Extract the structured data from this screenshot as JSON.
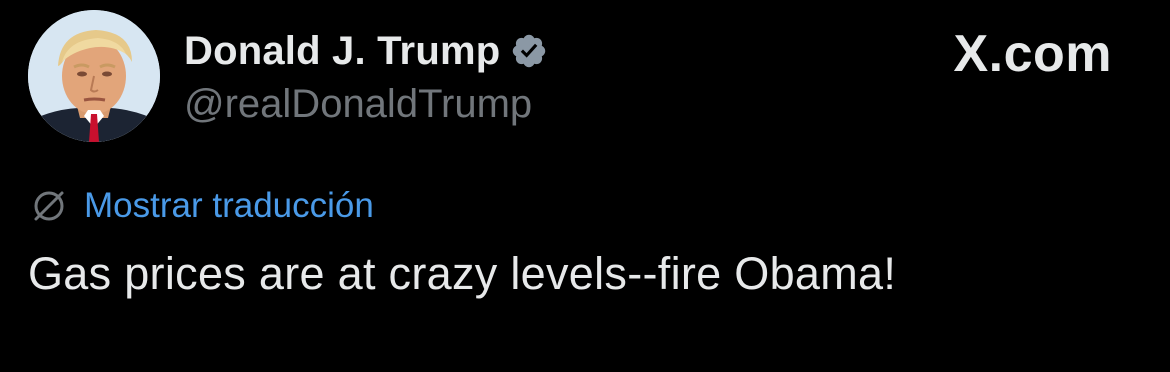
{
  "author": {
    "display_name": "Donald J. Trump",
    "handle": "@realDonaldTrump",
    "verified": true,
    "avatar_icon": "profile-photo-icon",
    "verified_icon": "verified-badge-icon"
  },
  "brand": {
    "label": "X.com"
  },
  "translation": {
    "icon": "translate-globe-icon",
    "label": "Mostrar traducción"
  },
  "tweet": {
    "text": "Gas prices are at crazy levels--fire Obama!"
  },
  "colors": {
    "background": "#000000",
    "primary_text": "#e7e9ea",
    "secondary_text": "#71767b",
    "link": "#4a9ae8",
    "verified_badge": "#8b98a5"
  }
}
